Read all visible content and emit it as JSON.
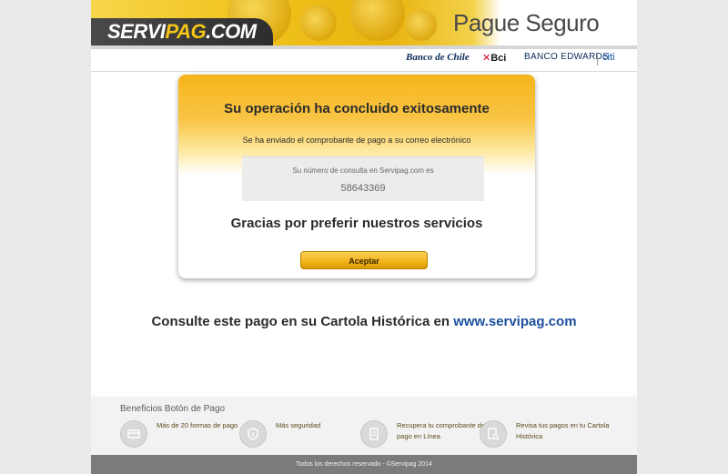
{
  "header": {
    "logo": {
      "part1": "SERVI",
      "part2": "PAG",
      "part3": ".COM"
    },
    "tagline": "Pague Seguro",
    "banks": {
      "chile": "Banco de Chile",
      "bci": "Bci",
      "edwards": "BANCO EDWARDS",
      "citi": "citi"
    }
  },
  "card": {
    "title": "Su operación ha concluido exitosamente",
    "subtitle": "Se ha enviado el comprobante de pago a su correo electrónico",
    "consult_label": "Su número de consulta en Servipag.com es",
    "consult_number": "58643369",
    "thanks": "Gracias por preferir nuestros servicios",
    "accept_label": "Aceptar"
  },
  "cartola": {
    "text": "Consulte este pago en su Cartola Histórica en",
    "link": "www.servipag.com"
  },
  "benefits": {
    "title": "Beneficios Botón de Pago",
    "items": [
      {
        "text": "Más de 20 formas de pago",
        "icon": "card-icon"
      },
      {
        "text": "Más seguridad",
        "icon": "shield-icon"
      },
      {
        "text": "Recupera tu comprobante de pago en Línea",
        "icon": "receipt-icon"
      },
      {
        "text": "Revisa tus pagos en tu Cartola Histórica",
        "icon": "document-search-icon"
      }
    ]
  },
  "footer": {
    "text": "Todos los derechos reservado - ©Servipag 2014"
  },
  "colors": {
    "accent": "#f2b21a",
    "link": "#1a4f9c",
    "footer": "#7b7b7b"
  }
}
